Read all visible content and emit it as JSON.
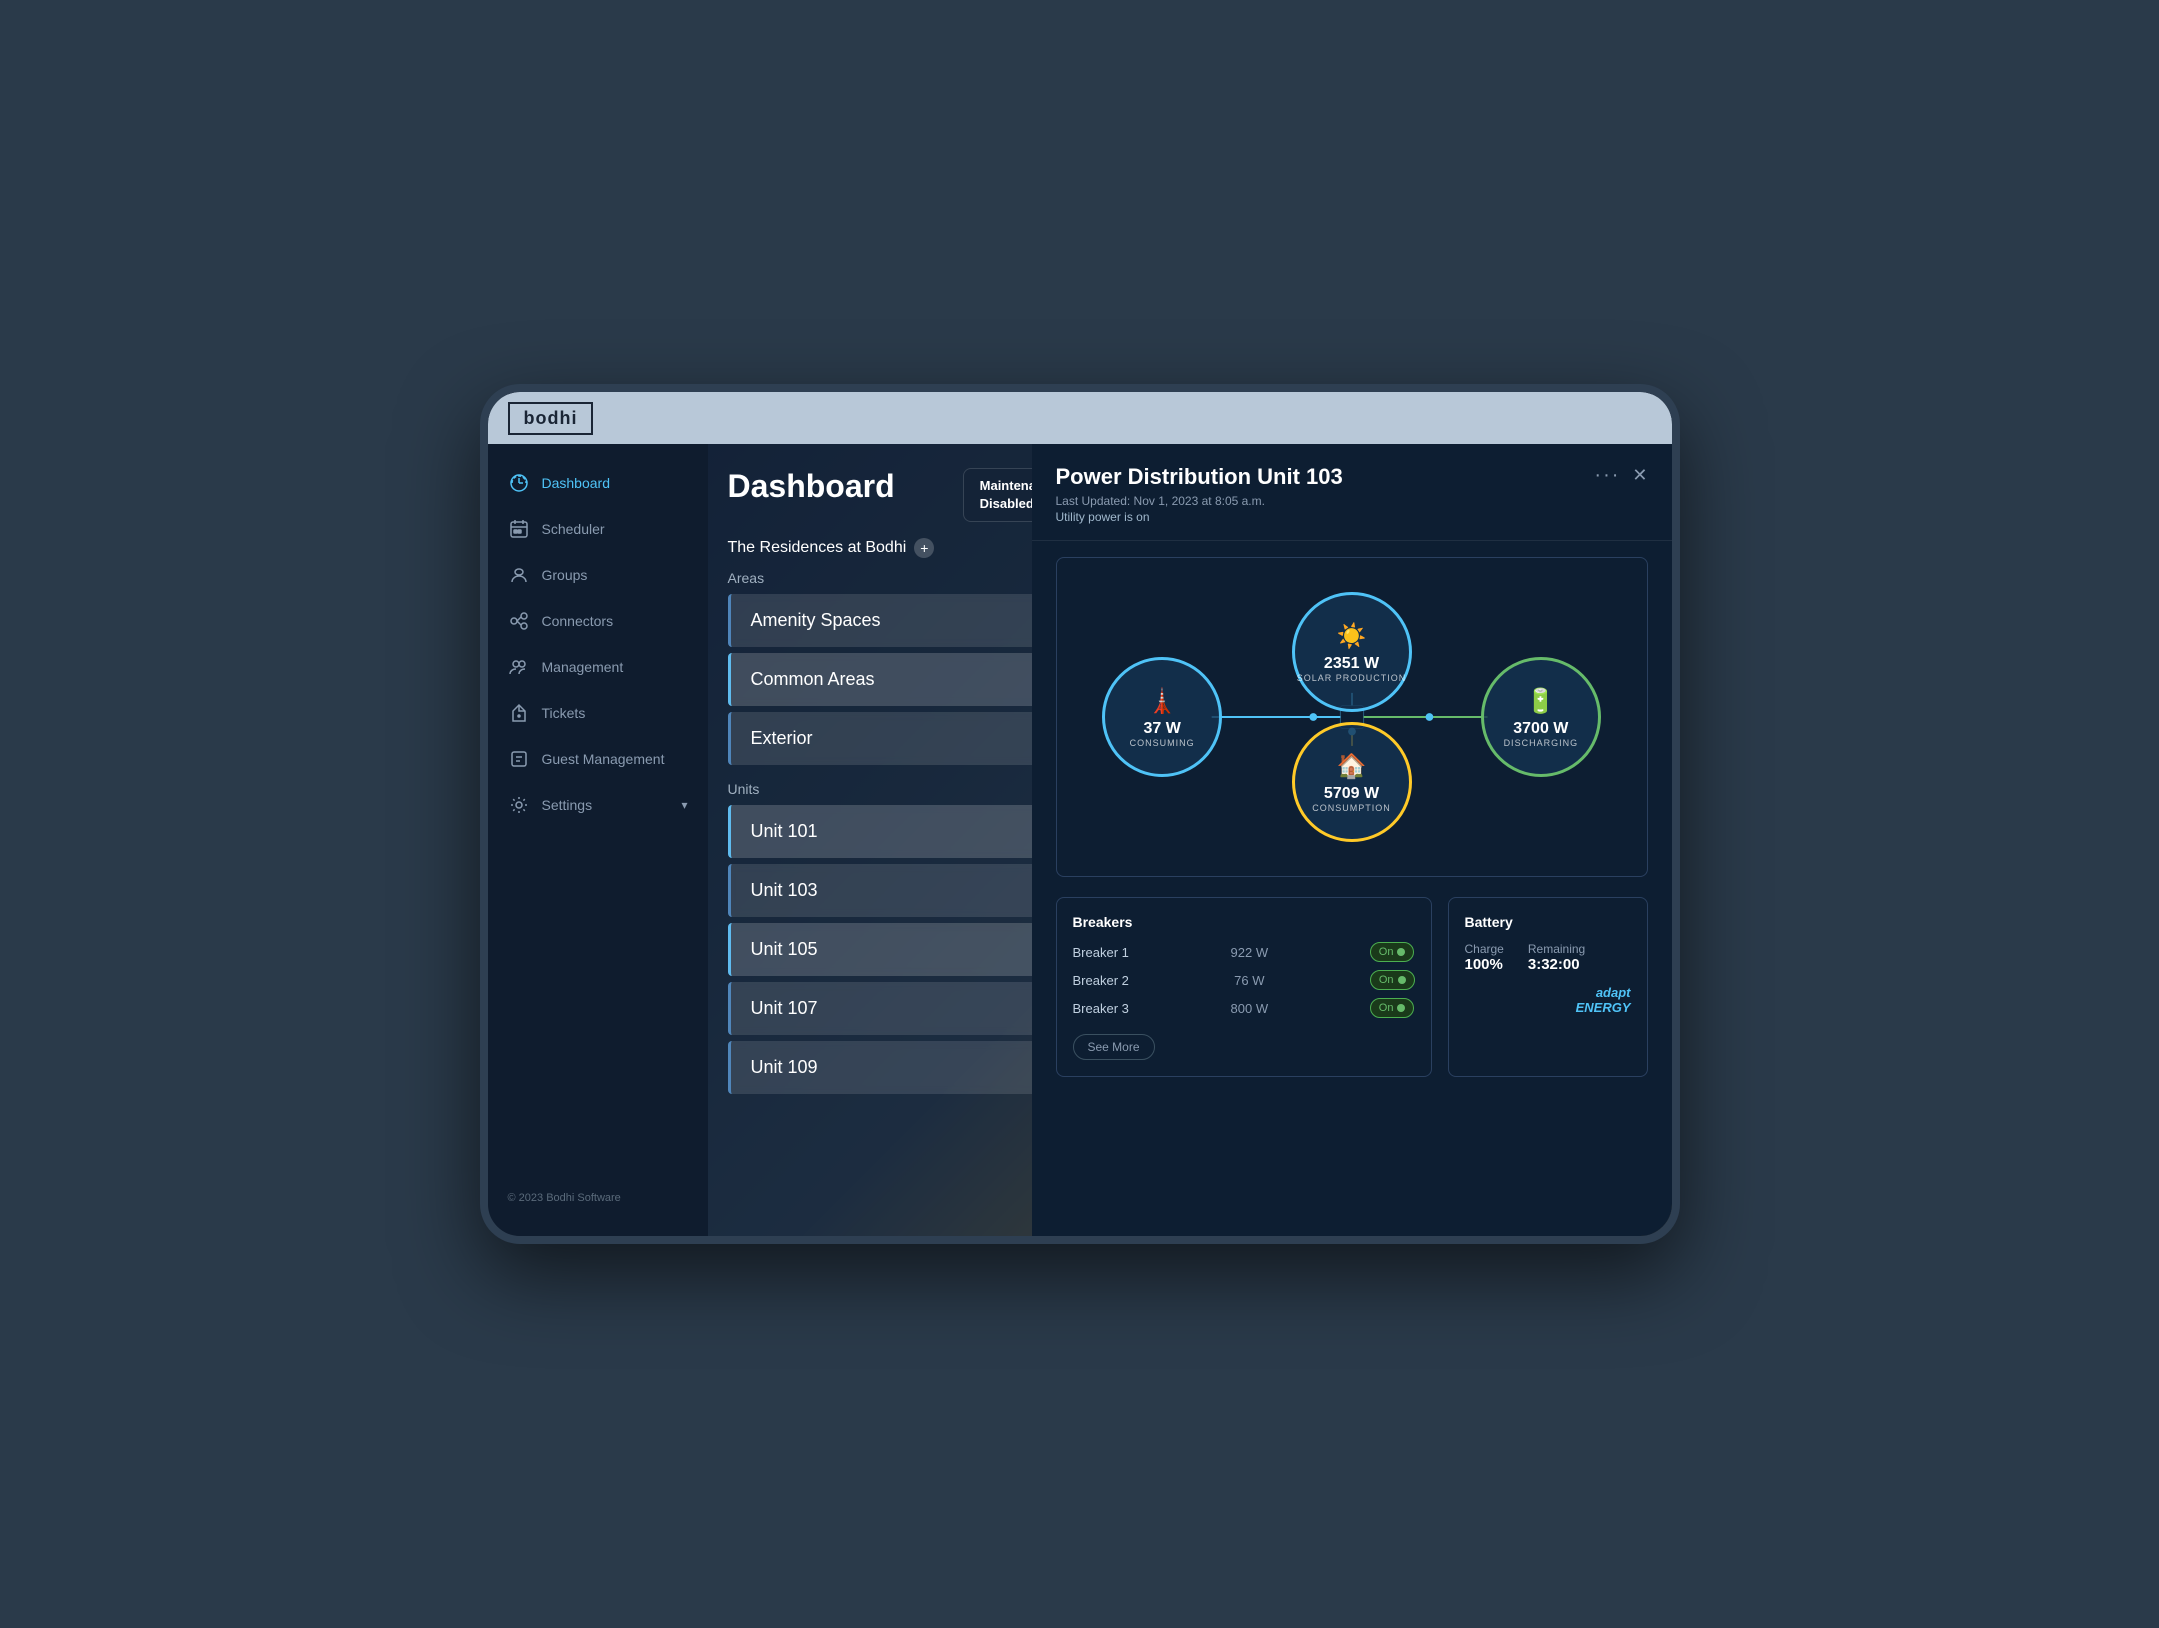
{
  "app": {
    "logo": "bodhi",
    "footer": "© 2023 Bodhi Software"
  },
  "sidebar": {
    "items": [
      {
        "id": "dashboard",
        "label": "Dashboard",
        "active": true
      },
      {
        "id": "scheduler",
        "label": "Scheduler",
        "active": false
      },
      {
        "id": "groups",
        "label": "Groups",
        "active": false
      },
      {
        "id": "connectors",
        "label": "Connectors",
        "active": false
      },
      {
        "id": "management",
        "label": "Management",
        "active": false
      },
      {
        "id": "tickets",
        "label": "Tickets",
        "active": false
      },
      {
        "id": "guest-management",
        "label": "Guest Management",
        "active": false
      }
    ],
    "settings_label": "Settings"
  },
  "dashboard": {
    "title": "Dashboard",
    "maintenance_badge": {
      "line1": "Maintenance Mo...",
      "line2": "Disabled"
    },
    "residences_label": "The Residences at Bodhi",
    "areas_label": "Areas",
    "areas": [
      {
        "label": "Amenity Spaces",
        "highlighted": false
      },
      {
        "label": "Common Areas",
        "highlighted": true
      },
      {
        "label": "Exterior",
        "highlighted": false
      }
    ],
    "units_label": "Units",
    "units": [
      {
        "label": "Unit 101"
      },
      {
        "label": "Unit 103"
      },
      {
        "label": "Unit 105"
      },
      {
        "label": "Unit 107"
      },
      {
        "label": "Unit 109"
      }
    ]
  },
  "panel": {
    "title": "Power Distribution Unit 103",
    "last_updated": "Last Updated: Nov 1, 2023 at 8:05 a.m.",
    "utility_status": "Utility power is on",
    "nodes": {
      "solar": {
        "value": "2351 W",
        "label": "SOLAR PRODUCTION"
      },
      "grid": {
        "value": "37 W",
        "label": "CONSUMING"
      },
      "battery": {
        "value": "3700 W",
        "label": "DISCHARGING"
      },
      "consumption": {
        "value": "5709 W",
        "label": "CONSUMPTION"
      }
    },
    "breakers": {
      "title": "Breakers",
      "items": [
        {
          "name": "Breaker 1",
          "value": "922 W",
          "status": "On"
        },
        {
          "name": "Breaker 2",
          "value": "76 W",
          "status": "On"
        },
        {
          "name": "Breaker 3",
          "value": "800 W",
          "status": "On"
        }
      ],
      "see_more": "See More"
    },
    "battery": {
      "title": "Battery",
      "charge_label": "Charge",
      "charge_value": "100%",
      "remaining_label": "Remaining",
      "remaining_value": "3:32:00"
    },
    "adapt_logo_line1": "adapt",
    "adapt_logo_line2": "ENERGY"
  }
}
